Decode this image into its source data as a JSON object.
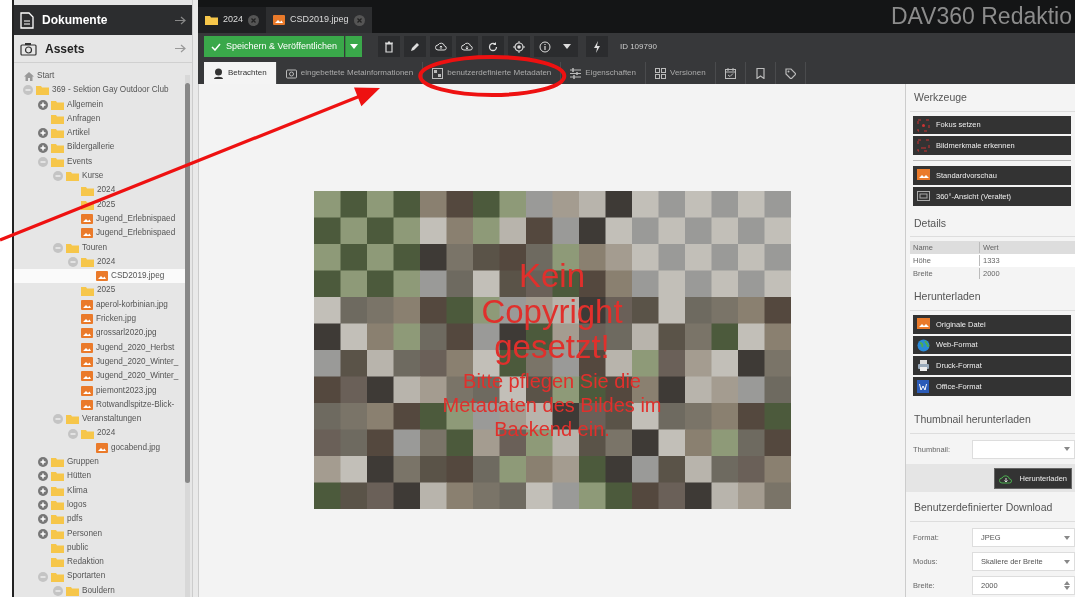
{
  "sidebar": {
    "header": "Dokumente",
    "section": "Assets",
    "tree": [
      {
        "label": "Start",
        "kind": "home",
        "selected": false
      },
      {
        "label": "369 - Sektion Gay Outdoor Club",
        "kind": "folder",
        "selected": false,
        "expanded": true,
        "children": [
          {
            "label": "Allgemein",
            "kind": "folder",
            "selected": false,
            "expanded": false
          },
          {
            "label": "Anfragen",
            "kind": "folder",
            "selected": false
          },
          {
            "label": "Artikel",
            "kind": "folder",
            "selected": false,
            "expanded": false
          },
          {
            "label": "Bildergallerie",
            "kind": "folder",
            "selected": false,
            "expanded": false
          },
          {
            "label": "Events",
            "kind": "folder",
            "selected": false,
            "expanded": true,
            "children": [
              {
                "label": "Kurse",
                "kind": "folder",
                "selected": false,
                "expanded": true,
                "children": [
                  {
                    "label": "2024",
                    "kind": "folder",
                    "selected": false
                  },
                  {
                    "label": "2025",
                    "kind": "folder",
                    "selected": false
                  },
                  {
                    "label": "Jugend_Erlebnispaed",
                    "kind": "image",
                    "selected": false
                  },
                  {
                    "label": "Jugend_Erlebnispaed",
                    "kind": "image",
                    "selected": false
                  }
                ]
              },
              {
                "label": "Touren",
                "kind": "folder",
                "selected": false,
                "expanded": true,
                "children": [
                  {
                    "label": "2024",
                    "kind": "folder",
                    "selected": false,
                    "expanded": true,
                    "children": [
                      {
                        "label": "CSD2019.jpeg",
                        "kind": "image",
                        "selected": true
                      }
                    ]
                  },
                  {
                    "label": "2025",
                    "kind": "folder",
                    "selected": false
                  },
                  {
                    "label": "aperol-korbinian.jpg",
                    "kind": "image",
                    "selected": false
                  },
                  {
                    "label": "Fricken.jpg",
                    "kind": "image",
                    "selected": false
                  },
                  {
                    "label": "grossarl2020.jpg",
                    "kind": "image",
                    "selected": false
                  },
                  {
                    "label": "Jugend_2020_Herbst",
                    "kind": "image",
                    "selected": false
                  },
                  {
                    "label": "Jugend_2020_Winter_",
                    "kind": "image",
                    "selected": false
                  },
                  {
                    "label": "Jugend_2020_Winter_",
                    "kind": "image",
                    "selected": false
                  },
                  {
                    "label": "piemont2023.jpg",
                    "kind": "image",
                    "selected": false
                  },
                  {
                    "label": "Rotwandlspitze-Blick-",
                    "kind": "image",
                    "selected": false
                  }
                ]
              },
              {
                "label": "Veranstaltungen",
                "kind": "folder",
                "selected": false,
                "expanded": true,
                "children": [
                  {
                    "label": "2024",
                    "kind": "folder",
                    "selected": false,
                    "expanded": true,
                    "children": [
                      {
                        "label": "gocabend.jpg",
                        "kind": "image",
                        "selected": false
                      }
                    ]
                  }
                ]
              }
            ]
          },
          {
            "label": "Gruppen",
            "kind": "folder",
            "selected": false,
            "expanded": false
          },
          {
            "label": "Hütten",
            "kind": "folder",
            "selected": false,
            "expanded": false
          },
          {
            "label": "Klima",
            "kind": "folder",
            "selected": false,
            "expanded": false
          },
          {
            "label": "logos",
            "kind": "folder",
            "selected": false,
            "expanded": false
          },
          {
            "label": "pdfs",
            "kind": "folder",
            "selected": false,
            "expanded": false
          },
          {
            "label": "Personen",
            "kind": "folder",
            "selected": false,
            "expanded": false
          },
          {
            "label": "public",
            "kind": "folder",
            "selected": false
          },
          {
            "label": "Redaktion",
            "kind": "folder",
            "selected": false
          },
          {
            "label": "Sportarten",
            "kind": "folder",
            "selected": false,
            "expanded": true,
            "children": [
              {
                "label": "Bouldern",
                "kind": "folder",
                "selected": false,
                "expanded": true
              }
            ]
          }
        ]
      }
    ]
  },
  "tabs": [
    {
      "label": "2024",
      "kind": "folder",
      "selected": false
    },
    {
      "label": "CSD2019.jpeg",
      "kind": "image",
      "selected": true
    }
  ],
  "app_title": "DAV360 Redaktio",
  "toolbar": {
    "save_label": "Speichern & Veröffentlichen",
    "id_label": "ID 109790"
  },
  "view_tabs": [
    {
      "kind": "text",
      "label": "Betrachten",
      "selected": true
    },
    {
      "kind": "text",
      "label": "eingebettete Metainformationen",
      "selected": false
    },
    {
      "kind": "text",
      "label": "benutzerdefinierte Metadaten",
      "selected": false
    },
    {
      "kind": "text",
      "label": "Eigenschaften",
      "selected": false
    },
    {
      "kind": "text",
      "label": "Versionen",
      "selected": false
    },
    {
      "kind": "icon",
      "selected": false
    },
    {
      "kind": "icon",
      "selected": false
    },
    {
      "kind": "icon",
      "selected": false
    }
  ],
  "preview": {
    "headline": "Kein Copyright gesetzt!",
    "message": "Bitte pflegen Sie die Metadaten des Bildes im Backend ein."
  },
  "panel": {
    "tools_title": "Werkzeuge",
    "tool_groups": [
      [
        "Fokus setzen",
        "Bildmerkmale erkennen"
      ],
      [
        "Standardvorschau",
        "360°-Ansicht (Veraltet)"
      ]
    ],
    "details_title": "Details",
    "details_columns": [
      "Name",
      "Wert"
    ],
    "details_rows": [
      [
        "Höhe",
        "1333"
      ],
      [
        "Breite",
        "2000"
      ]
    ],
    "download_title": "Herunterladen",
    "downloads": [
      "Originale Datei",
      "Web-Format",
      "Druck-Format",
      "Office-Format"
    ],
    "thumbnail_title": "Thumbnail herunterladen",
    "thumbnail_label": "Thumbnail:",
    "thumbnail_button": "Herunterladen",
    "custom_title": "Benutzerdefinierter Download",
    "custom_fields": [
      {
        "label": "Format:",
        "value": "JPEG",
        "kind": "select"
      },
      {
        "label": "Modus:",
        "value": "Skaliere der Breite",
        "kind": "select"
      },
      {
        "label": "Breite:",
        "value": "2000",
        "kind": "number"
      }
    ]
  },
  "annotations": [
    {
      "kind": "arrow"
    },
    {
      "kind": "ellipse"
    }
  ]
}
